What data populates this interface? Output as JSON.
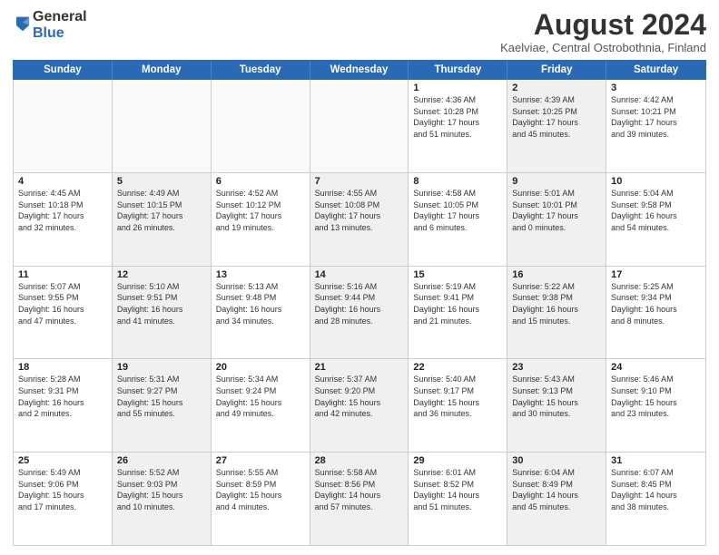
{
  "logo": {
    "general": "General",
    "blue": "Blue"
  },
  "title": "August 2024",
  "subtitle": "Kaelviae, Central Ostrobothnia, Finland",
  "header_days": [
    "Sunday",
    "Monday",
    "Tuesday",
    "Wednesday",
    "Thursday",
    "Friday",
    "Saturday"
  ],
  "weeks": [
    [
      {
        "day": "",
        "text": "",
        "empty": true
      },
      {
        "day": "",
        "text": "",
        "empty": true
      },
      {
        "day": "",
        "text": "",
        "empty": true
      },
      {
        "day": "",
        "text": "",
        "empty": true
      },
      {
        "day": "1",
        "text": "Sunrise: 4:36 AM\nSunset: 10:28 PM\nDaylight: 17 hours\nand 51 minutes.",
        "shaded": false
      },
      {
        "day": "2",
        "text": "Sunrise: 4:39 AM\nSunset: 10:25 PM\nDaylight: 17 hours\nand 45 minutes.",
        "shaded": true
      },
      {
        "day": "3",
        "text": "Sunrise: 4:42 AM\nSunset: 10:21 PM\nDaylight: 17 hours\nand 39 minutes.",
        "shaded": false
      }
    ],
    [
      {
        "day": "4",
        "text": "Sunrise: 4:45 AM\nSunset: 10:18 PM\nDaylight: 17 hours\nand 32 minutes.",
        "shaded": false
      },
      {
        "day": "5",
        "text": "Sunrise: 4:49 AM\nSunset: 10:15 PM\nDaylight: 17 hours\nand 26 minutes.",
        "shaded": true
      },
      {
        "day": "6",
        "text": "Sunrise: 4:52 AM\nSunset: 10:12 PM\nDaylight: 17 hours\nand 19 minutes.",
        "shaded": false
      },
      {
        "day": "7",
        "text": "Sunrise: 4:55 AM\nSunset: 10:08 PM\nDaylight: 17 hours\nand 13 minutes.",
        "shaded": true
      },
      {
        "day": "8",
        "text": "Sunrise: 4:58 AM\nSunset: 10:05 PM\nDaylight: 17 hours\nand 6 minutes.",
        "shaded": false
      },
      {
        "day": "9",
        "text": "Sunrise: 5:01 AM\nSunset: 10:01 PM\nDaylight: 17 hours\nand 0 minutes.",
        "shaded": true
      },
      {
        "day": "10",
        "text": "Sunrise: 5:04 AM\nSunset: 9:58 PM\nDaylight: 16 hours\nand 54 minutes.",
        "shaded": false
      }
    ],
    [
      {
        "day": "11",
        "text": "Sunrise: 5:07 AM\nSunset: 9:55 PM\nDaylight: 16 hours\nand 47 minutes.",
        "shaded": false
      },
      {
        "day": "12",
        "text": "Sunrise: 5:10 AM\nSunset: 9:51 PM\nDaylight: 16 hours\nand 41 minutes.",
        "shaded": true
      },
      {
        "day": "13",
        "text": "Sunrise: 5:13 AM\nSunset: 9:48 PM\nDaylight: 16 hours\nand 34 minutes.",
        "shaded": false
      },
      {
        "day": "14",
        "text": "Sunrise: 5:16 AM\nSunset: 9:44 PM\nDaylight: 16 hours\nand 28 minutes.",
        "shaded": true
      },
      {
        "day": "15",
        "text": "Sunrise: 5:19 AM\nSunset: 9:41 PM\nDaylight: 16 hours\nand 21 minutes.",
        "shaded": false
      },
      {
        "day": "16",
        "text": "Sunrise: 5:22 AM\nSunset: 9:38 PM\nDaylight: 16 hours\nand 15 minutes.",
        "shaded": true
      },
      {
        "day": "17",
        "text": "Sunrise: 5:25 AM\nSunset: 9:34 PM\nDaylight: 16 hours\nand 8 minutes.",
        "shaded": false
      }
    ],
    [
      {
        "day": "18",
        "text": "Sunrise: 5:28 AM\nSunset: 9:31 PM\nDaylight: 16 hours\nand 2 minutes.",
        "shaded": false
      },
      {
        "day": "19",
        "text": "Sunrise: 5:31 AM\nSunset: 9:27 PM\nDaylight: 15 hours\nand 55 minutes.",
        "shaded": true
      },
      {
        "day": "20",
        "text": "Sunrise: 5:34 AM\nSunset: 9:24 PM\nDaylight: 15 hours\nand 49 minutes.",
        "shaded": false
      },
      {
        "day": "21",
        "text": "Sunrise: 5:37 AM\nSunset: 9:20 PM\nDaylight: 15 hours\nand 42 minutes.",
        "shaded": true
      },
      {
        "day": "22",
        "text": "Sunrise: 5:40 AM\nSunset: 9:17 PM\nDaylight: 15 hours\nand 36 minutes.",
        "shaded": false
      },
      {
        "day": "23",
        "text": "Sunrise: 5:43 AM\nSunset: 9:13 PM\nDaylight: 15 hours\nand 30 minutes.",
        "shaded": true
      },
      {
        "day": "24",
        "text": "Sunrise: 5:46 AM\nSunset: 9:10 PM\nDaylight: 15 hours\nand 23 minutes.",
        "shaded": false
      }
    ],
    [
      {
        "day": "25",
        "text": "Sunrise: 5:49 AM\nSunset: 9:06 PM\nDaylight: 15 hours\nand 17 minutes.",
        "shaded": false
      },
      {
        "day": "26",
        "text": "Sunrise: 5:52 AM\nSunset: 9:03 PM\nDaylight: 15 hours\nand 10 minutes.",
        "shaded": true
      },
      {
        "day": "27",
        "text": "Sunrise: 5:55 AM\nSunset: 8:59 PM\nDaylight: 15 hours\nand 4 minutes.",
        "shaded": false
      },
      {
        "day": "28",
        "text": "Sunrise: 5:58 AM\nSunset: 8:56 PM\nDaylight: 14 hours\nand 57 minutes.",
        "shaded": true
      },
      {
        "day": "29",
        "text": "Sunrise: 6:01 AM\nSunset: 8:52 PM\nDaylight: 14 hours\nand 51 minutes.",
        "shaded": false
      },
      {
        "day": "30",
        "text": "Sunrise: 6:04 AM\nSunset: 8:49 PM\nDaylight: 14 hours\nand 45 minutes.",
        "shaded": true
      },
      {
        "day": "31",
        "text": "Sunrise: 6:07 AM\nSunset: 8:45 PM\nDaylight: 14 hours\nand 38 minutes.",
        "shaded": false
      }
    ]
  ]
}
